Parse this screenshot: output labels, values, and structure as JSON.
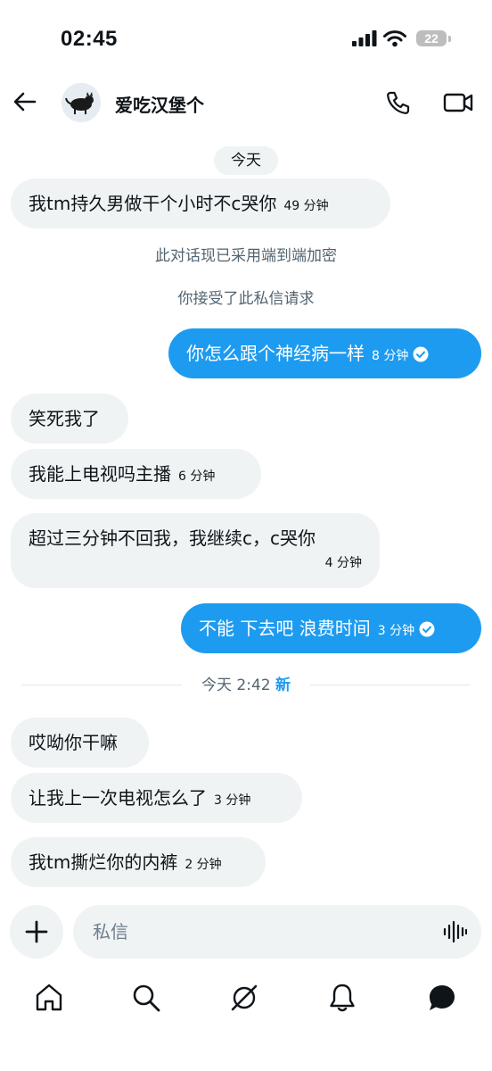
{
  "status_bar": {
    "time": "02:45",
    "battery": "22"
  },
  "header": {
    "contact_name": "爱吃汉堡个"
  },
  "date_pill": "今天",
  "system_messages": {
    "encryption": "此对话现已采用端到端加密",
    "accepted": "你接受了此私信请求"
  },
  "messages": [
    {
      "direction": "in",
      "text": "我tm持久男做干个小时不c哭你",
      "time": "49 分钟"
    },
    {
      "direction": "out",
      "text": "你怎么跟个神经病一样",
      "time": "8 分钟",
      "read": true
    },
    {
      "direction": "in",
      "text": "笑死我了",
      "time": ""
    },
    {
      "direction": "in",
      "text": "我能上电视吗主播",
      "time": "6 分钟"
    },
    {
      "direction": "in",
      "text": "超过三分钟不回我，我继续c，c哭你",
      "time": "4 分钟"
    },
    {
      "direction": "out",
      "text": "不能 下去吧 浪费时间",
      "time": "3 分钟",
      "read": true
    },
    {
      "direction": "in",
      "text": "哎呦你干嘛",
      "time": ""
    },
    {
      "direction": "in",
      "text": "让我上一次电视怎么了",
      "time": "3 分钟"
    },
    {
      "direction": "in",
      "text": "我tm撕烂你的内裤",
      "time": "2 分钟"
    }
  ],
  "divider": {
    "label": "今天 2:42",
    "new_label": "新"
  },
  "composer": {
    "placeholder": "私信"
  },
  "tabs": [
    "home-icon",
    "search-icon",
    "grok-icon",
    "notifications-icon",
    "messages-icon"
  ],
  "colors": {
    "accent": "#1d9bf0",
    "bubble_in": "#eff3f4",
    "text": "#0f1419",
    "muted": "#536471"
  }
}
